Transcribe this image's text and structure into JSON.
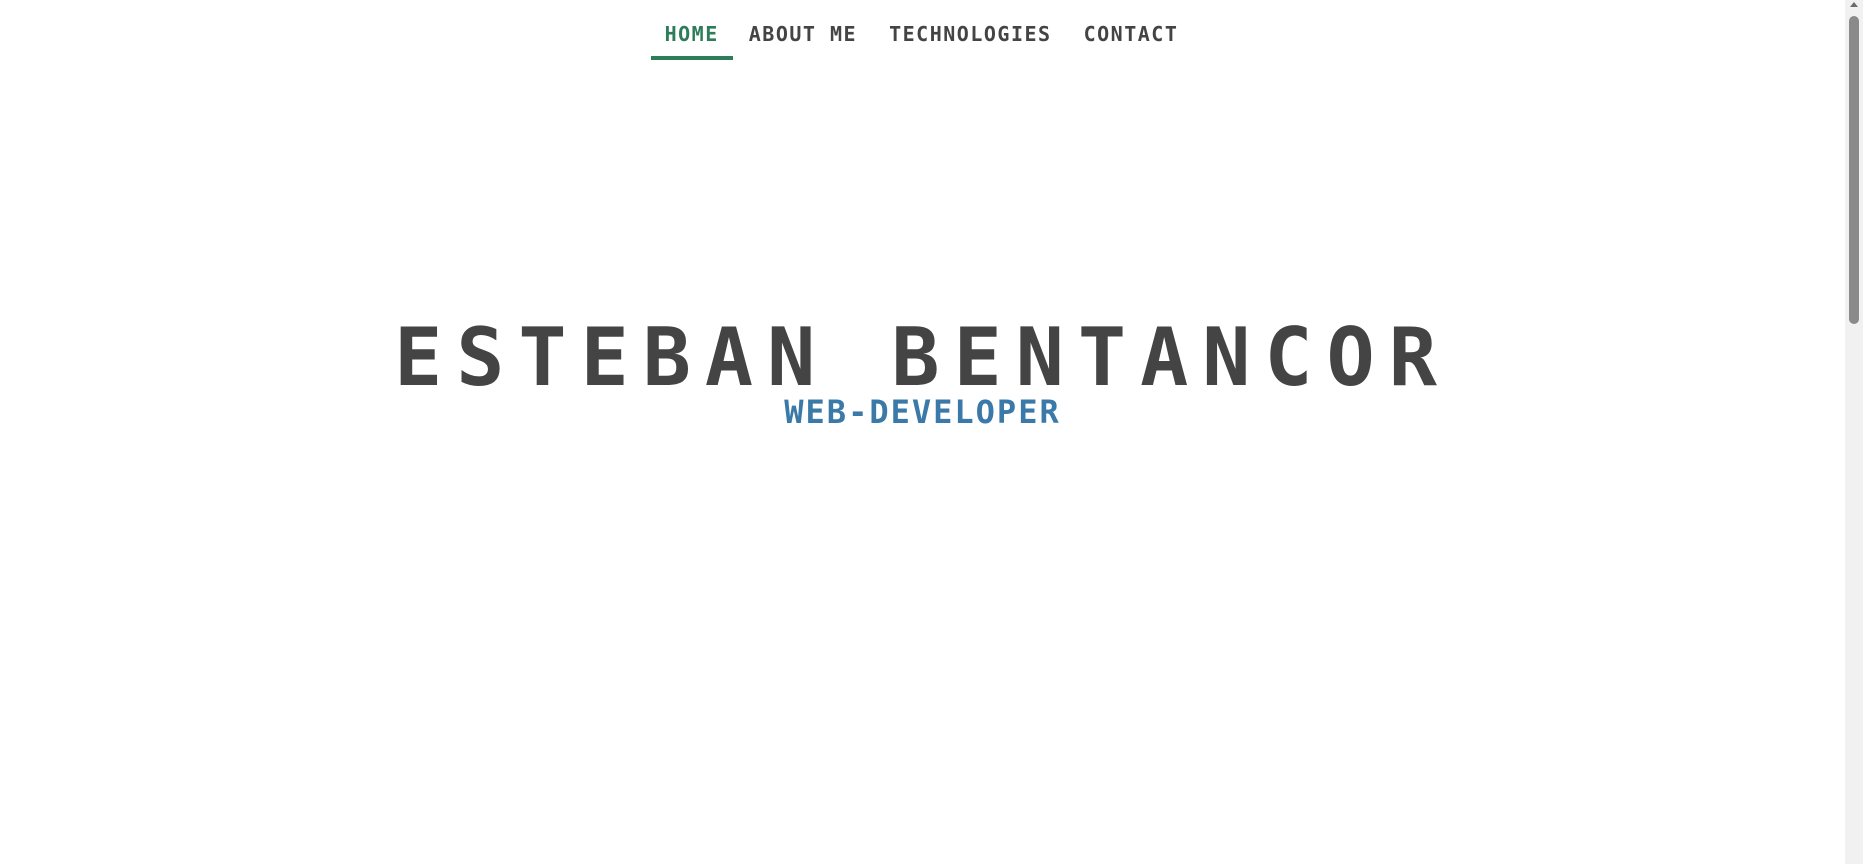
{
  "nav": {
    "items": [
      {
        "label": "HOME",
        "active": true
      },
      {
        "label": "ABOUT ME",
        "active": false
      },
      {
        "label": "TECHNOLOGIES",
        "active": false
      },
      {
        "label": "CONTACT",
        "active": false
      }
    ]
  },
  "hero": {
    "name": "ESTEBAN BENTANCOR",
    "subtitle": "WEB-DEVELOPER"
  },
  "colors": {
    "accent": "#2e7d5a",
    "text": "#444444",
    "subtitle": "#3a79a8",
    "background": "#ffffff"
  },
  "icons": {
    "scroll_up": "arrow-up-icon"
  }
}
